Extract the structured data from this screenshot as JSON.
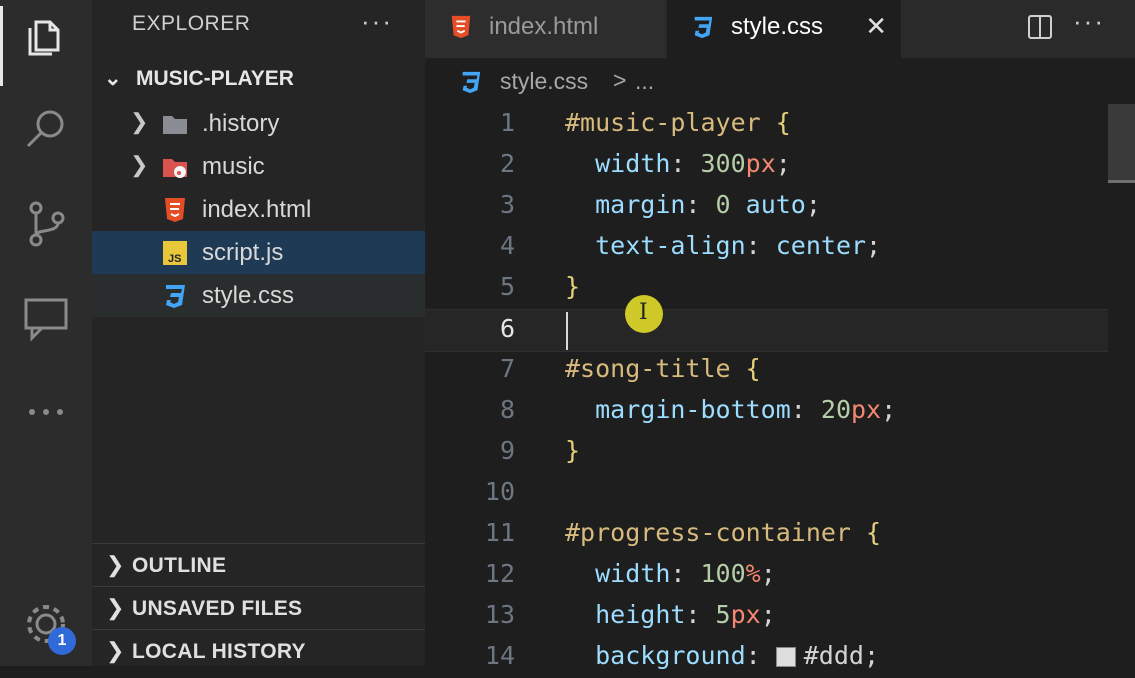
{
  "activity_bar": {
    "badge": "1",
    "icons": [
      "files-icon",
      "search-icon",
      "source-control-icon",
      "remote-explorer-icon",
      "more-icon",
      "gear-icon"
    ]
  },
  "sidebar": {
    "header": "EXPLORER",
    "more": "···",
    "project": "MUSIC-PLAYER",
    "items": [
      {
        "label": ".history",
        "type": "folder"
      },
      {
        "label": "music",
        "type": "music-folder"
      },
      {
        "label": "index.html",
        "type": "html"
      },
      {
        "label": "script.js",
        "type": "js"
      },
      {
        "label": "style.css",
        "type": "css"
      }
    ],
    "sections": [
      {
        "label": "OUTLINE"
      },
      {
        "label": "UNSAVED FILES"
      },
      {
        "label": "LOCAL HISTORY"
      }
    ]
  },
  "tabs": [
    {
      "label": "index.html",
      "active": false
    },
    {
      "label": "style.css",
      "active": true,
      "close": "✕"
    }
  ],
  "tabs_more": "···",
  "breadcrumb": {
    "file": "style.css",
    "separator": ">",
    "rest": "..."
  },
  "editor": {
    "current_line": 6,
    "line_numbers": [
      "1",
      "2",
      "3",
      "4",
      "5",
      "6",
      "7",
      "8",
      "9",
      "10",
      "11",
      "12",
      "13",
      "14"
    ],
    "lines": [
      [
        [
          "sel",
          "#music-player"
        ],
        [
          "punc",
          " "
        ],
        [
          "brace",
          "{"
        ]
      ],
      [
        [
          "punc",
          "  "
        ],
        [
          "prop",
          "width"
        ],
        [
          "punc",
          ": "
        ],
        [
          "num",
          "300"
        ],
        [
          "unit",
          "px"
        ],
        [
          "punc",
          ";"
        ]
      ],
      [
        [
          "punc",
          "  "
        ],
        [
          "prop",
          "margin"
        ],
        [
          "punc",
          ": "
        ],
        [
          "num",
          "0"
        ],
        [
          "punc",
          " "
        ],
        [
          "kw",
          "auto"
        ],
        [
          "punc",
          ";"
        ]
      ],
      [
        [
          "punc",
          "  "
        ],
        [
          "prop",
          "text-align"
        ],
        [
          "punc",
          ": "
        ],
        [
          "kw",
          "center"
        ],
        [
          "punc",
          ";"
        ]
      ],
      [
        [
          "brace",
          "}"
        ]
      ],
      [],
      [
        [
          "sel",
          "#song-title"
        ],
        [
          "punc",
          " "
        ],
        [
          "brace",
          "{"
        ]
      ],
      [
        [
          "punc",
          "  "
        ],
        [
          "prop",
          "margin-bottom"
        ],
        [
          "punc",
          ": "
        ],
        [
          "num",
          "20"
        ],
        [
          "unit",
          "px"
        ],
        [
          "punc",
          ";"
        ]
      ],
      [
        [
          "brace",
          "}"
        ]
      ],
      [],
      [
        [
          "sel",
          "#progress-container"
        ],
        [
          "punc",
          " "
        ],
        [
          "brace",
          "{"
        ]
      ],
      [
        [
          "punc",
          "  "
        ],
        [
          "prop",
          "width"
        ],
        [
          "punc",
          ": "
        ],
        [
          "num",
          "100"
        ],
        [
          "unit",
          "%"
        ],
        [
          "punc",
          ";"
        ]
      ],
      [
        [
          "punc",
          "  "
        ],
        [
          "prop",
          "height"
        ],
        [
          "punc",
          ": "
        ],
        [
          "num",
          "5"
        ],
        [
          "unit",
          "px"
        ],
        [
          "punc",
          ";"
        ]
      ],
      [
        [
          "punc",
          "  "
        ],
        [
          "prop",
          "background"
        ],
        [
          "punc",
          ": "
        ],
        [
          "swatch",
          ""
        ],
        [
          "punc",
          "#ddd;"
        ]
      ]
    ]
  }
}
